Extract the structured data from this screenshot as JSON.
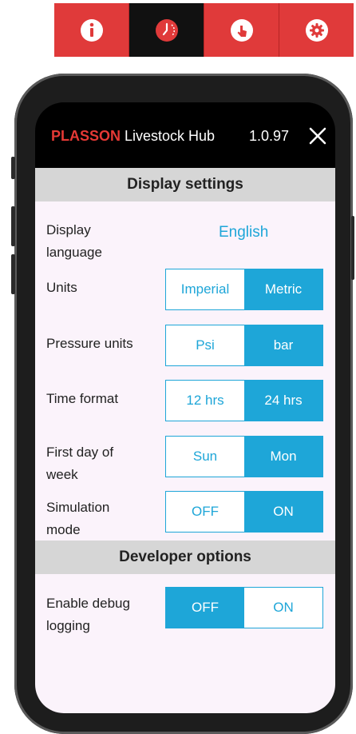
{
  "tabs": [
    {
      "name": "info-icon",
      "active": false
    },
    {
      "name": "clock-icon",
      "active": true
    },
    {
      "name": "touch-icon",
      "active": false
    },
    {
      "name": "gear-icon",
      "active": false
    }
  ],
  "header": {
    "brand": "PLASSON",
    "app_name": " Livestock Hub",
    "version": "1.0.97",
    "close_icon": "close-icon"
  },
  "display_settings": {
    "title": "Display settings",
    "language_label": "Display language",
    "language_value": "English",
    "units_label": "Units",
    "units_options": [
      "Imperial",
      "Metric"
    ],
    "pressure_label": "Pressure units",
    "pressure_options": [
      "Psi",
      "bar"
    ],
    "time_label": "Time format",
    "time_options": [
      "12 hrs",
      "24 hrs"
    ],
    "firstday_label": "First day of week",
    "firstday_options": [
      "Sun",
      "Mon"
    ],
    "simulation_label": "Simulation mode",
    "simulation_options": [
      "OFF",
      "ON"
    ]
  },
  "developer_options": {
    "title": "Developer options",
    "debug_label": "Enable debug logging",
    "debug_options": [
      "OFF",
      "ON"
    ]
  },
  "colors": {
    "accent": "#1ea6d8",
    "brand_red": "#e53935",
    "tab_red": "#e03a3a"
  }
}
